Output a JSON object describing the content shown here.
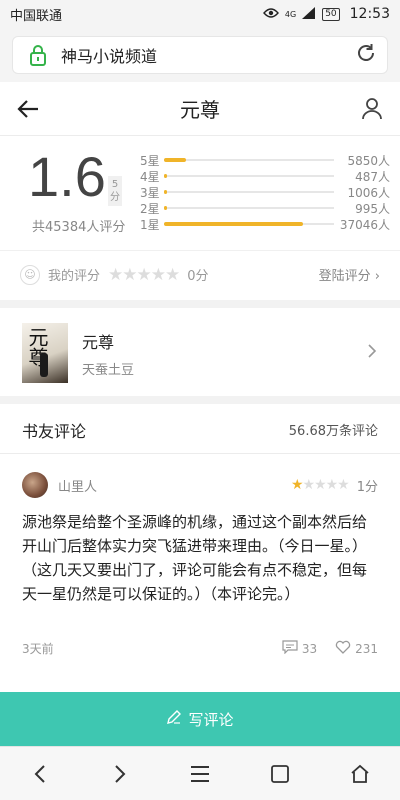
{
  "status_bar": {
    "carrier": "中国联通",
    "network": "4G",
    "battery": "50",
    "time": "12:53"
  },
  "url_bar": {
    "site_name": "神马小说频道"
  },
  "header": {
    "title": "元尊"
  },
  "rating": {
    "score": "1.6",
    "score_unit": "5分",
    "total": "共45384人评分",
    "distribution": [
      {
        "label": "5星",
        "count": "5850人",
        "fraction": 0.13
      },
      {
        "label": "4星",
        "count": "487人",
        "fraction": 0.01
      },
      {
        "label": "3星",
        "count": "1006人",
        "fraction": 0.02
      },
      {
        "label": "2星",
        "count": "995人",
        "fraction": 0.02
      },
      {
        "label": "1星",
        "count": "37046人",
        "fraction": 0.82
      }
    ]
  },
  "my_rating": {
    "label": "我的评分",
    "stars": "★★★★★",
    "score": "0分",
    "login_label": "登陆评分 ›"
  },
  "book": {
    "cover_text": "元尊",
    "name": "元尊",
    "author": "天蚕土豆"
  },
  "comments": {
    "heading": "书友评论",
    "count": "56.68万条评论"
  },
  "comment": {
    "user": "山里人",
    "stars_on": "★",
    "stars_off": "★★★★",
    "score": "1分",
    "text": "源池祭是给整个圣源峰的机缘，通过这个副本然后给开山门后整体实力突飞猛进带来理由。（今日一星。）（这几天又要出门了，评论可能会有点不稳定，但每天一星仍然是可以保证的。）（本评论完。）",
    "time": "3天前",
    "replies": "33",
    "likes": "231"
  },
  "write_button": {
    "label": "写评论"
  },
  "colors": {
    "accent": "#3ec7b1",
    "star": "#f0b429"
  }
}
